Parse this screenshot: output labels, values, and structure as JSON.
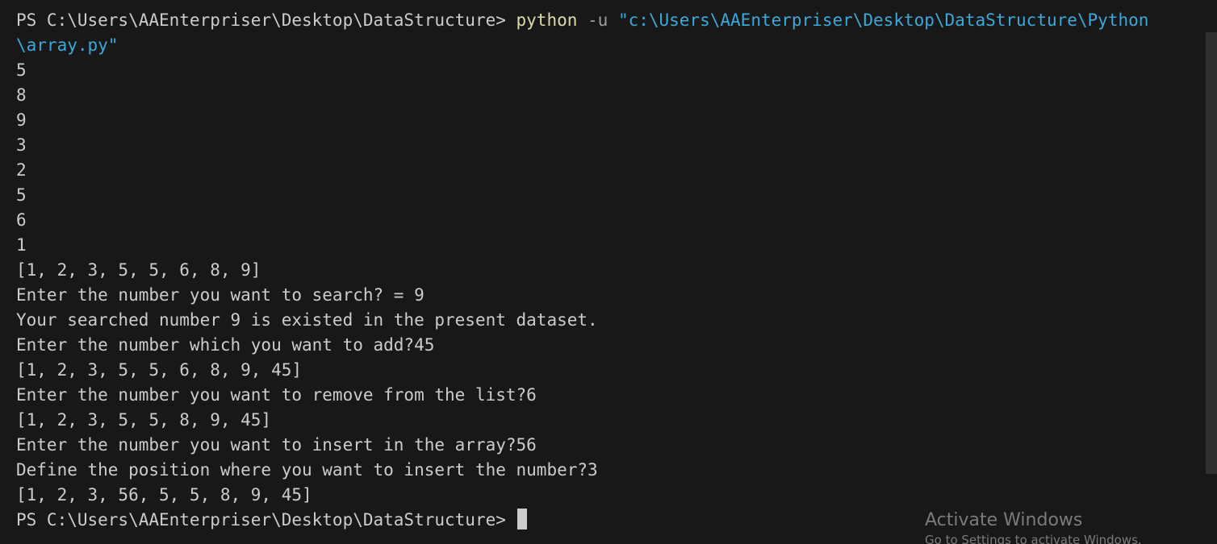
{
  "terminal": {
    "command_line": {
      "prompt": "PS C:\\Users\\AAEnterpriser\\Desktop\\DataStructure> ",
      "program": "python",
      "flag": " -u ",
      "path_part1": "\"c:\\Users\\AAEnterpriser\\Desktop\\DataStructure\\Python",
      "path_part2": "\\array.py\""
    },
    "output_lines": [
      "5",
      "8",
      "9",
      "3",
      "2",
      "5",
      "6",
      "1",
      "[1, 2, 3, 5, 5, 6, 8, 9]",
      "Enter the number you want to search? = 9",
      "Your searched number 9 is existed in the present dataset.",
      "Enter the number which you want to add?45",
      "[1, 2, 3, 5, 5, 6, 8, 9, 45]",
      "Enter the number you want to remove from the list?6",
      "[1, 2, 3, 5, 5, 8, 9, 45]",
      "Enter the number you want to insert in the array?56",
      "Define the position where you want to insert the number?3",
      "[1, 2, 3, 56, 5, 5, 8, 9, 45]"
    ],
    "final_prompt": "PS C:\\Users\\AAEnterpriser\\Desktop\\DataStructure>"
  },
  "watermark": {
    "title": "Activate Windows",
    "subtitle": "Go to Settings to activate Windows."
  },
  "colors": {
    "background": "#181818",
    "text": "#cccccc",
    "command": "#dcdcaa",
    "flag": "#9d9d9d",
    "string": "#3aa8d9"
  }
}
